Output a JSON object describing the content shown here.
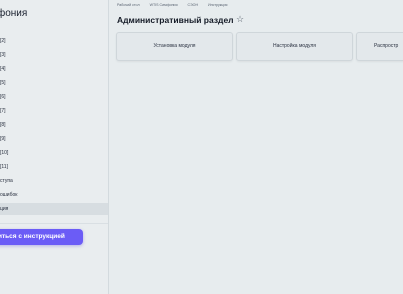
{
  "sidebar": {
    "title": "фония",
    "items": [
      {
        "label": "[2]"
      },
      {
        "label": "[3]"
      },
      {
        "label": "[4]"
      },
      {
        "label": "[5]"
      },
      {
        "label": "[6]"
      },
      {
        "label": "[7]"
      },
      {
        "label": "[8]"
      },
      {
        "label": "[9]"
      },
      {
        "label": "[10]"
      },
      {
        "label": "[11]"
      },
      {
        "label": "ступа"
      },
      {
        "label": "ошибок"
      },
      {
        "label": "ция"
      }
    ],
    "button_label": "иться с инструкцией"
  },
  "breadcrumb": [
    "Рабочий стол",
    "WTIS Симфония",
    "СЭОН",
    "Инструкция"
  ],
  "page": {
    "title": "Административный раздел"
  },
  "cards": [
    {
      "label": "Установка модуля"
    },
    {
      "label": "Настройка модуля"
    },
    {
      "label": "Распростр"
    }
  ]
}
